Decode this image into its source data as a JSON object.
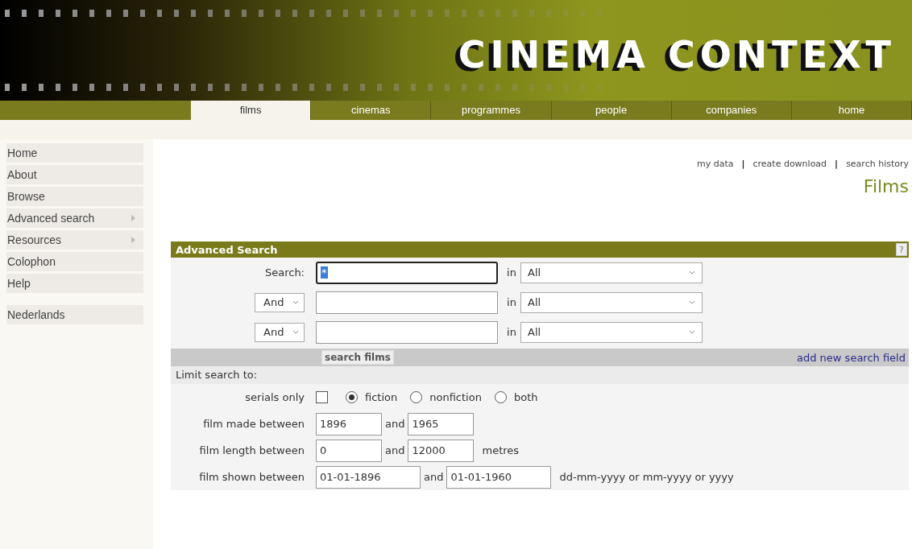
{
  "header": {
    "logo": "CINEMA CONTEXT"
  },
  "tabs": [
    {
      "label": "films",
      "selected": true
    },
    {
      "label": "cinemas",
      "selected": false
    },
    {
      "label": "programmes",
      "selected": false
    },
    {
      "label": "people",
      "selected": false
    },
    {
      "label": "companies",
      "selected": false
    },
    {
      "label": "home",
      "selected": false
    }
  ],
  "sidebar": {
    "items": [
      {
        "label": "Home",
        "has_submenu": false
      },
      {
        "label": "About",
        "has_submenu": false
      },
      {
        "label": "Browse",
        "has_submenu": false
      },
      {
        "label": "Advanced search",
        "has_submenu": true
      },
      {
        "label": "Resources",
        "has_submenu": true
      },
      {
        "label": "Colophon",
        "has_submenu": false
      },
      {
        "label": "Help",
        "has_submenu": false
      }
    ],
    "language": "Nederlands"
  },
  "top_links": [
    {
      "kind": "link",
      "label": "my data"
    },
    {
      "kind": "separator",
      "label": "|"
    },
    {
      "kind": "link",
      "label": "create download"
    },
    {
      "kind": "separator",
      "label": "|"
    },
    {
      "kind": "link",
      "label": "search history"
    }
  ],
  "page_title": "Films",
  "panel": {
    "title": "Advanced Search",
    "help": "?",
    "search_rows": [
      {
        "kind": "label",
        "label": "Search:",
        "value": "*",
        "focused": true,
        "in_label": "in",
        "field": "All"
      },
      {
        "kind": "connector",
        "connector": "And",
        "value": "",
        "focused": false,
        "in_label": "in",
        "field": "All"
      },
      {
        "kind": "connector",
        "connector": "And",
        "value": "",
        "focused": false,
        "in_label": "in",
        "field": "All"
      }
    ],
    "search_button": "search films",
    "add_link": "add new search field",
    "limit_title": "Limit search to:",
    "limit_rows": [
      {
        "kind": "options",
        "label": "serials only",
        "checked": false,
        "radios": [
          {
            "label": "fiction",
            "selected": true
          },
          {
            "label": "nonfiction",
            "selected": false
          },
          {
            "label": "both",
            "selected": false
          }
        ]
      },
      {
        "kind": "range",
        "label": "film made between",
        "from": "1896",
        "and": "and",
        "to": "1965"
      },
      {
        "kind": "range",
        "label": "film length between",
        "from": "0",
        "and": "and",
        "to": "12000",
        "suffix": "metres"
      },
      {
        "kind": "date_range",
        "label": "film shown between",
        "from": "01-01-1896",
        "and": "and",
        "to": "01-01-1960",
        "suffix": "dd-mm-yyyy or mm-yyyy or yyyy"
      }
    ]
  }
}
